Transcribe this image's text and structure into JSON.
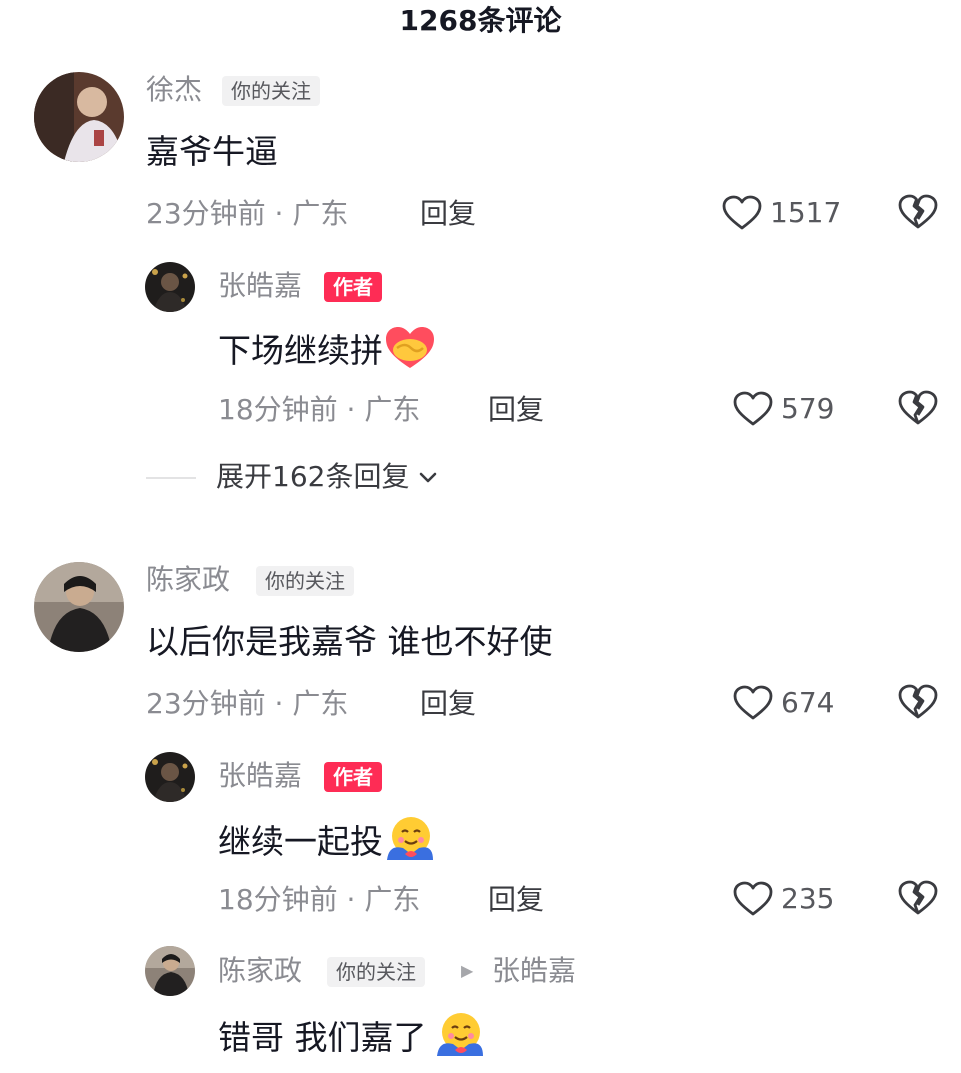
{
  "header": {
    "title": "1268条评论"
  },
  "comments": [
    {
      "author": "徐杰",
      "badge": "你的关注",
      "text": "嘉爷牛逼",
      "time_location": "23分钟前 · 广东",
      "reply_label": "回复",
      "likes": "1517",
      "replies": [
        {
          "author": "张皓嘉",
          "badge": "作者",
          "text": "下场继续拼",
          "emoji": "handshake-heart-emoji",
          "time_location": "18分钟前 · 广东",
          "reply_label": "回复",
          "likes": "579"
        }
      ],
      "expand_label": "展开162条回复"
    },
    {
      "author": "陈家政",
      "badge": "你的关注",
      "text": "以后你是我嘉爷 谁也不好使",
      "time_location": "23分钟前 · 广东",
      "reply_label": "回复",
      "likes": "674",
      "replies": [
        {
          "author": "张皓嘉",
          "badge": "作者",
          "text": "继续一起投",
          "emoji": "hugging-emoji",
          "time_location": "18分钟前 · 广东",
          "reply_label": "回复",
          "likes": "235"
        },
        {
          "author": "陈家政",
          "badge": "你的关注",
          "reply_to": "张皓嘉",
          "text": "错哥 我们嘉了",
          "emoji": "hugging-emoji"
        }
      ]
    }
  ],
  "icons": {
    "like": "heart-outline-icon",
    "dislike": "broken-heart-icon",
    "expand": "chevron-down-icon",
    "reply_arrow": "triangle-right-icon"
  },
  "colors": {
    "accent": "#fe2c55",
    "muted_text": "#8a8b91",
    "primary_text": "#161823"
  }
}
